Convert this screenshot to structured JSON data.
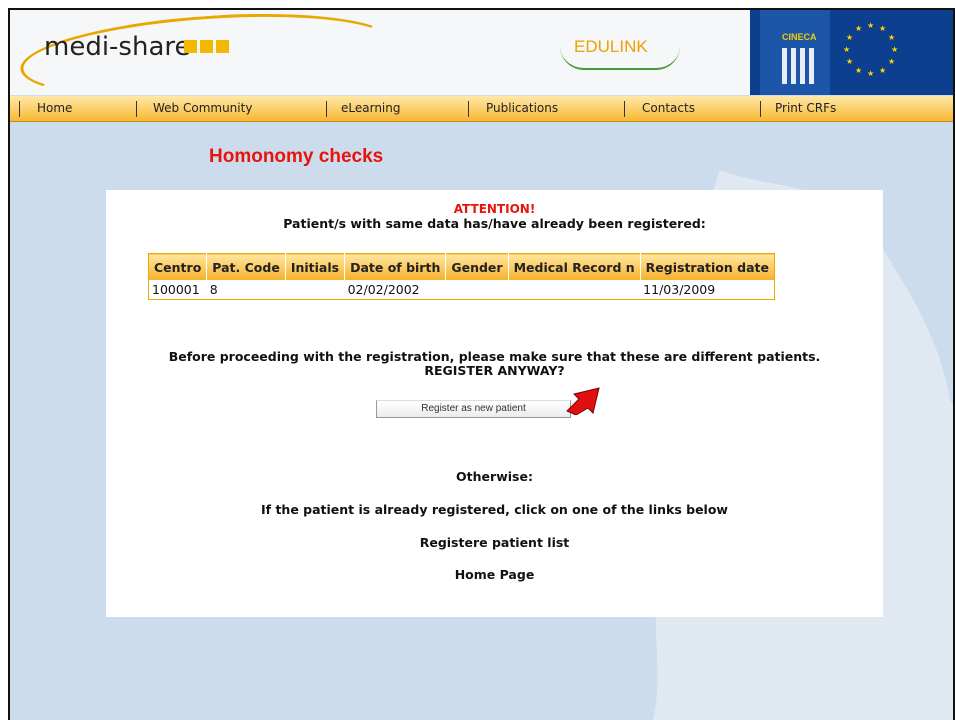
{
  "header": {
    "logo_text": "medi-share",
    "edulink_text": "EDULINK",
    "cineca_text": "CINECA"
  },
  "nav": {
    "items": [
      "Home",
      "Web Community",
      "eLearning",
      "Publications",
      "Contacts",
      "Print CRFs"
    ]
  },
  "page": {
    "title": "Homonomy checks",
    "attention": "ATTENTION!",
    "already_registered": "Patient/s with same data has/have already been registered:",
    "before_proceeding": "Before proceeding with the registration, please make sure that these are different patients.",
    "register_anyway": "REGISTER ANYWAY?",
    "register_button": "Register as new patient",
    "otherwise": "Otherwise:",
    "if_registered": "If the patient is already registered, click on one of the links below",
    "patient_list_link": "Registere patient list",
    "home_page_link": "Home Page"
  },
  "table": {
    "headers": [
      "Centro",
      "Pat. Code",
      "Initials",
      "Date of birth",
      "Gender",
      "Medical Record n",
      "Registration date"
    ],
    "rows": [
      [
        "100001",
        "8",
        "",
        "02/02/2002",
        "",
        "",
        "11/03/2009"
      ]
    ]
  },
  "colors": {
    "title_red": "#e8140c",
    "nav_orange": "#f7b833",
    "background": "#ccdcec"
  }
}
